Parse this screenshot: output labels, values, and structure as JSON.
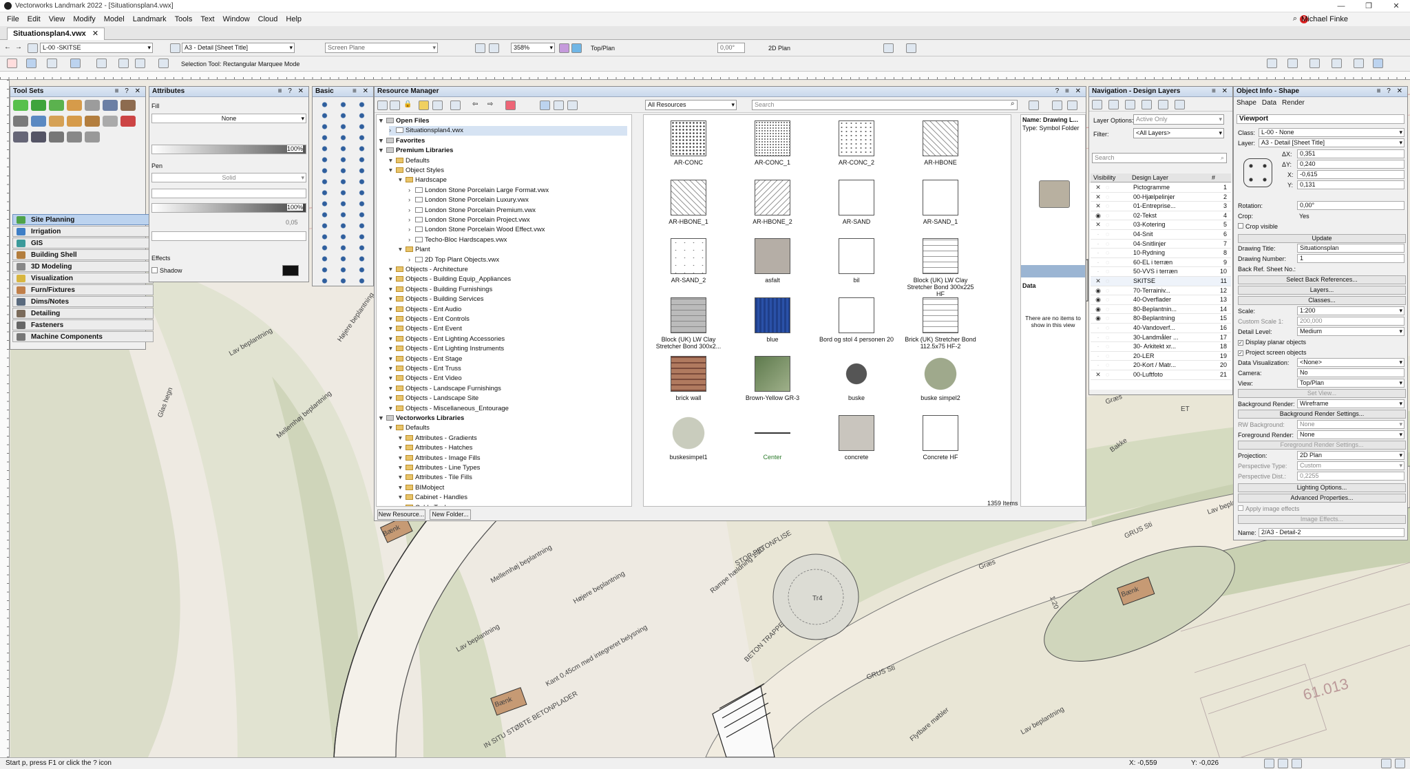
{
  "app": {
    "title": "Vectorworks Landmark 2022 - [Situationsplan4.vwx]",
    "user": "Michael Finke",
    "notifications": "2"
  },
  "menu": [
    "File",
    "Edit",
    "View",
    "Modify",
    "Model",
    "Landmark",
    "Tools",
    "Text",
    "Window",
    "Cloud",
    "Help"
  ],
  "doc_tab": "Situationsplan4.vwx",
  "viewbar": {
    "layer": "L-00 -SKITSE",
    "sheet": "A3 - Detail [Sheet Title]",
    "plane": "Screen Plane",
    "zoom": "358%",
    "view": "Top/Plan",
    "angle": "0,00°",
    "render": "2D Plan"
  },
  "modebar": {
    "tool_hint": "Selection Tool: Rectangular Marquee Mode"
  },
  "ruler_top": [
    "1,550",
    "1,555",
    "1,560",
    "1,565",
    "1,570",
    "1,575",
    "1,580",
    "1,585",
    "1,590",
    "1,595",
    "1,600",
    "1,605",
    "1,610",
    "1,615",
    "1,620",
    "1,625",
    "1,630",
    "1,635",
    "1,640",
    "1,645",
    "1,650",
    "1,655",
    "1,660"
  ],
  "ruler_left": [
    "0,055",
    "0,050",
    "0,045",
    "0,040",
    "0,035",
    "0,030",
    "0,025",
    "0,020",
    "0,015",
    "0,010",
    "0,005",
    "0,000",
    "-0,005",
    "-0,010",
    "-0,015"
  ],
  "tool_sets": {
    "title": "Tool Sets",
    "categories": [
      "Site Planning",
      "Irrigation",
      "GIS",
      "Building Shell",
      "3D Modeling",
      "Visualization",
      "Furn/Fixtures",
      "Dims/Notes",
      "Detailing",
      "Fasteners",
      "Machine Components"
    ],
    "selected": "Site Planning"
  },
  "attributes": {
    "title": "Attributes",
    "fill_label": "Fill",
    "fill_value": "None",
    "opacity1": "100%",
    "pen_label": "Pen",
    "pen_value": "Solid",
    "opacity2": "100%",
    "thickness": "0,05",
    "effects_label": "Effects",
    "shadow_label": "Shadow"
  },
  "basic": {
    "title": "Basic"
  },
  "resource_manager": {
    "title": "Resource Manager",
    "filter": "All Resources",
    "search_placeholder": "Search",
    "tree": [
      {
        "label": "Open Files",
        "level": 0,
        "type": "section"
      },
      {
        "label": "Situationsplan4.vwx",
        "level": 1,
        "type": "file",
        "selected": true
      },
      {
        "label": "Favorites",
        "level": 0,
        "type": "section"
      },
      {
        "label": "Premium Libraries",
        "level": 0,
        "type": "section"
      },
      {
        "label": "Defaults",
        "level": 1,
        "type": "folder"
      },
      {
        "label": "Object Styles",
        "level": 1,
        "type": "folder"
      },
      {
        "label": "Hardscape",
        "level": 2,
        "type": "folder"
      },
      {
        "label": "London Stone Porcelain Large Format.vwx",
        "level": 3,
        "type": "file"
      },
      {
        "label": "London Stone Porcelain Luxury.vwx",
        "level": 3,
        "type": "file"
      },
      {
        "label": "London Stone Porcelain Premium.vwx",
        "level": 3,
        "type": "file"
      },
      {
        "label": "London Stone Porcelain Project.vwx",
        "level": 3,
        "type": "file"
      },
      {
        "label": "London Stone Porcelain Wood Effect.vwx",
        "level": 3,
        "type": "file"
      },
      {
        "label": "Techo-Bloc Hardscapes.vwx",
        "level": 3,
        "type": "file"
      },
      {
        "label": "Plant",
        "level": 2,
        "type": "folder"
      },
      {
        "label": "2D Top Plant Objects.vwx",
        "level": 3,
        "type": "file"
      },
      {
        "label": "Objects - Architecture",
        "level": 1,
        "type": "folder"
      },
      {
        "label": "Objects - Building Equip_Appliances",
        "level": 1,
        "type": "folder"
      },
      {
        "label": "Objects - Building Furnishings",
        "level": 1,
        "type": "folder"
      },
      {
        "label": "Objects - Building Services",
        "level": 1,
        "type": "folder"
      },
      {
        "label": "Objects - Ent Audio",
        "level": 1,
        "type": "folder"
      },
      {
        "label": "Objects - Ent Controls",
        "level": 1,
        "type": "folder"
      },
      {
        "label": "Objects - Ent Event",
        "level": 1,
        "type": "folder"
      },
      {
        "label": "Objects - Ent Lighting Accessories",
        "level": 1,
        "type": "folder"
      },
      {
        "label": "Objects - Ent Lighting Instruments",
        "level": 1,
        "type": "folder"
      },
      {
        "label": "Objects - Ent Stage",
        "level": 1,
        "type": "folder"
      },
      {
        "label": "Objects - Ent Truss",
        "level": 1,
        "type": "folder"
      },
      {
        "label": "Objects - Ent Video",
        "level": 1,
        "type": "folder"
      },
      {
        "label": "Objects - Landscape Furnishings",
        "level": 1,
        "type": "folder"
      },
      {
        "label": "Objects - Landscape Site",
        "level": 1,
        "type": "folder"
      },
      {
        "label": "Objects - Miscellaneous_Entourage",
        "level": 1,
        "type": "folder"
      },
      {
        "label": "Vectorworks Libraries",
        "level": 0,
        "type": "section"
      },
      {
        "label": "Defaults",
        "level": 1,
        "type": "folder"
      },
      {
        "label": "Attributes - Gradients",
        "level": 2,
        "type": "folder"
      },
      {
        "label": "Attributes - Hatches",
        "level": 2,
        "type": "folder"
      },
      {
        "label": "Attributes - Image Fills",
        "level": 2,
        "type": "folder"
      },
      {
        "label": "Attributes - Line Types",
        "level": 2,
        "type": "folder"
      },
      {
        "label": "Attributes - Tile Fills",
        "level": 2,
        "type": "folder"
      },
      {
        "label": "BIMobject",
        "level": 2,
        "type": "folder"
      },
      {
        "label": "Cabinet - Handles",
        "level": 2,
        "type": "folder"
      },
      {
        "label": "Cable Tools",
        "level": 2,
        "type": "folder"
      }
    ],
    "items": [
      {
        "name": "AR-CONC",
        "style": "dots"
      },
      {
        "name": "AR-CONC_1",
        "style": "dots2"
      },
      {
        "name": "AR-CONC_2",
        "style": "dots3"
      },
      {
        "name": "AR-HBONE",
        "style": "hbone"
      },
      {
        "name": "AR-HBONE_1",
        "style": "hbone"
      },
      {
        "name": "AR-HBONE_2",
        "style": "hbone2"
      },
      {
        "name": "AR-SAND",
        "style": "plain"
      },
      {
        "name": "AR-SAND_1",
        "style": "plain"
      },
      {
        "name": "AR-SAND_2",
        "style": "speck"
      },
      {
        "name": "asfalt",
        "style": "asfalt"
      },
      {
        "name": "bil",
        "style": "car"
      },
      {
        "name": "Block (UK) LW Clay Stretcher Bond 300x225 HF",
        "style": "brick"
      },
      {
        "name": "Block (UK) LW Clay Stretcher Bond 300x2...",
        "style": "block"
      },
      {
        "name": "blue",
        "style": "blue"
      },
      {
        "name": "Bord og stol 4 personen 20",
        "style": "table"
      },
      {
        "name": "Brick (UK) Stretcher Bond 112.5x75 HF-2",
        "style": "brick"
      },
      {
        "name": "brick wall",
        "style": "brickwall"
      },
      {
        "name": "Brown-Yellow GR-3",
        "style": "green"
      },
      {
        "name": "buske",
        "style": "bush"
      },
      {
        "name": "buske simpel2",
        "style": "circlegreen"
      },
      {
        "name": "buskesimpel1",
        "style": "circlelight"
      },
      {
        "name": "Center",
        "style": "line"
      },
      {
        "name": "concrete",
        "style": "concrete"
      },
      {
        "name": "Concrete HF",
        "style": "triangle"
      }
    ],
    "count": "1359 Items",
    "info_name": "Name: Drawing L...",
    "info_type": "Type: Symbol Folder",
    "data_label": "Data",
    "data_empty": "There are no items to show in this view",
    "btn_new_resource": "New Resource...",
    "btn_new_folder": "New Folder..."
  },
  "navigation": {
    "title": "Navigation - Design Layers",
    "layer_options_label": "Layer Options:",
    "layer_options_value": "Active Only",
    "filter_label": "Filter:",
    "filter_value": "<All Layers>",
    "search_placeholder": "Search",
    "col_visibility": "Visibility",
    "col_layer": "Design Layer",
    "col_num": "#",
    "layers": [
      {
        "name": "Pictogramme",
        "n": "1",
        "vis": "x"
      },
      {
        "name": "00-Hjælpelinjer",
        "n": "2",
        "vis": "x"
      },
      {
        "name": "01-Entreprise...",
        "n": "3",
        "vis": "x"
      },
      {
        "name": "02-Tekst",
        "n": "4",
        "vis": "eye"
      },
      {
        "name": "03-Kotering",
        "n": "5",
        "vis": "x"
      },
      {
        "name": "04-Snit",
        "n": "6",
        "vis": "g"
      },
      {
        "name": "04-Snitlinjer",
        "n": "7",
        "vis": "g"
      },
      {
        "name": "10-Rydning",
        "n": "8",
        "vis": "g"
      },
      {
        "name": "60-EL i terræn",
        "n": "9",
        "vis": "g"
      },
      {
        "name": "50-VVS i terræn",
        "n": "10",
        "vis": "g"
      },
      {
        "name": "SKITSE",
        "n": "11",
        "vis": "x"
      },
      {
        "name": "70-Terrainiv...",
        "n": "12",
        "vis": "eye"
      },
      {
        "name": "40-Overflader",
        "n": "13",
        "vis": "eye"
      },
      {
        "name": "80-Beplantnin...",
        "n": "14",
        "vis": "eye"
      },
      {
        "name": "80-Beplantning",
        "n": "15",
        "vis": "eye"
      },
      {
        "name": "40-Vandoverf...",
        "n": "16",
        "vis": "g"
      },
      {
        "name": "30-Landmåler ...",
        "n": "17",
        "vis": "g"
      },
      {
        "name": "30- Arkitekt xr...",
        "n": "18",
        "vis": "g"
      },
      {
        "name": "20-LER",
        "n": "19",
        "vis": "g"
      },
      {
        "name": "20-Kort / Matr...",
        "n": "20",
        "vis": "g"
      },
      {
        "name": "00-Luftfoto",
        "n": "21",
        "vis": "x"
      }
    ]
  },
  "object_info": {
    "title": "Object Info - Shape",
    "tabs": [
      "Shape",
      "Data",
      "Render"
    ],
    "section": "Viewport",
    "class_label": "Class:",
    "class_value": "L-00 - None",
    "layer_label": "Layer:",
    "layer_value": "A3 - Detail [Sheet Title]",
    "dx_label": "ΔX:",
    "dx": "0,351",
    "dy_label": "ΔY:",
    "dy": "0,240",
    "x_label": "X:",
    "x": "-0,615",
    "y_label": "Y:",
    "y": "0,131",
    "rotation_label": "Rotation:",
    "rotation": "0,00°",
    "crop_label": "Crop:",
    "crop": "Yes",
    "crop_visible": "Crop visible",
    "update": "Update",
    "drawing_title_label": "Drawing Title:",
    "drawing_title": "Situationsplan",
    "drawing_number_label": "Drawing Number:",
    "drawing_number": "1",
    "back_ref_label": "Back Ref. Sheet No.:",
    "select_back_refs": "Select Back References...",
    "layers_btn": "Layers...",
    "classes_btn": "Classes...",
    "scale_label": "Scale:",
    "scale": "1:200",
    "custom_scale_label": "Custom Scale 1:",
    "custom_scale": "200,000",
    "detail_level_label": "Detail Level:",
    "detail_level": "Medium",
    "display_planar": "Display planar objects",
    "project_screen": "Project screen objects",
    "data_vis_label": "Data Visualization:",
    "data_vis": "<None>",
    "camera_label": "Camera:",
    "camera": "No",
    "view_label": "View:",
    "view": "Top/Plan",
    "set_view": "Set View...",
    "bg_render_label": "Background Render:",
    "bg_render": "Wireframe",
    "bg_render_settings": "Background Render Settings...",
    "rw_bg_label": "RW Background:",
    "rw_bg": "None",
    "fg_render_label": "Foreground Render:",
    "fg_render": "None",
    "fg_render_settings": "Foreground Render Settings...",
    "projection_label": "Projection:",
    "projection": "2D Plan",
    "persp_type_label": "Perspective Type:",
    "persp_type": "Custom",
    "persp_dist_label": "Perspective Dist.:",
    "persp_dist": "0,2255",
    "lighting": "Lighting Options...",
    "advanced": "Advanced Properties...",
    "apply_image": "Apply image effects",
    "image_effects": "Image Effects...",
    "name_label": "Name:",
    "name": "2/A3 - Detail-2"
  },
  "canvas": {
    "labels": [
      "Lav beplantning",
      "Højere beplantning",
      "Mellemhøj beplantning",
      "Glas hegn",
      "IN SITU STØBTE BETONPLADER",
      "STOR BETONFLISE",
      "Rampe hældning 1:20",
      "BETON TRAPPE",
      "GRUS Sti",
      "GRUS Sti",
      "Græs",
      "Græs",
      "Bænk",
      "Bænk",
      "Bænk",
      "Kant 0,45cm med integreret belysning",
      "Flytbare møbler",
      "Tr4",
      "1:20",
      "ET",
      "Bakke",
      "Lav beplantning",
      "Lav beplantning",
      "Mellemhøj beplantning",
      "Højere beplantning",
      "Lav beplantning",
      "61.013"
    ]
  },
  "status": {
    "hint": "Start  p, press F1 or click the ? icon",
    "x": "X: -0,559",
    "y": "Y: -0,026"
  }
}
